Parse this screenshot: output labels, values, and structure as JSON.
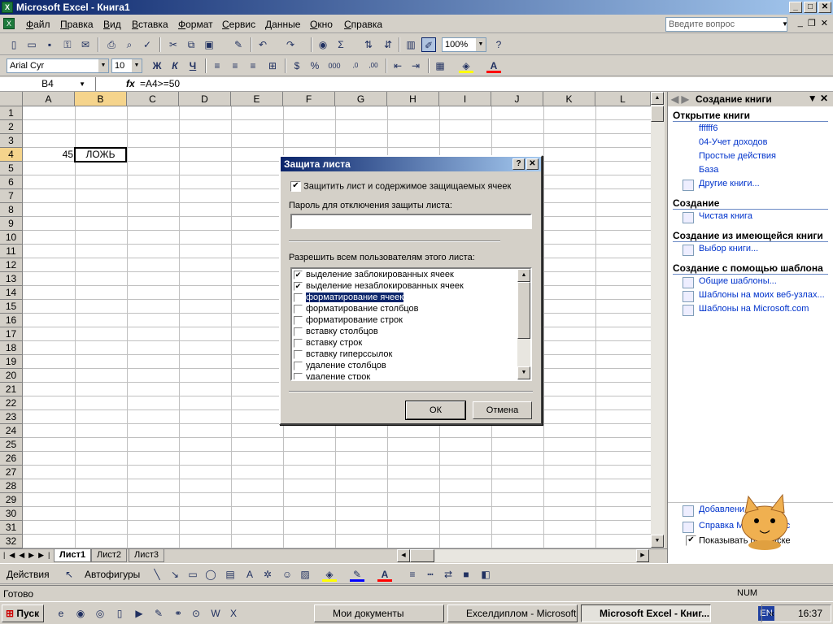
{
  "window": {
    "title": "Microsoft Excel - Книга1"
  },
  "menu": [
    "Файл",
    "Правка",
    "Вид",
    "Вставка",
    "Формат",
    "Сервис",
    "Данные",
    "Окно",
    "Справка"
  ],
  "question_box": {
    "placeholder": "Введите вопрос"
  },
  "toolbar": {
    "zoom": "100%",
    "font": "Arial Cyr",
    "size": "10",
    "bold": "Ж",
    "italic": "К",
    "underline": "Ч"
  },
  "formula_bar": {
    "name_box": "B4",
    "fx": "fx",
    "formula": "=A4>=50"
  },
  "columns": [
    "A",
    "B",
    "C",
    "D",
    "E",
    "F",
    "G",
    "H",
    "I",
    "J",
    "K",
    "L"
  ],
  "rows": [
    "1",
    "2",
    "3",
    "4",
    "5",
    "6",
    "7",
    "8",
    "9",
    "10",
    "11",
    "12",
    "13",
    "14",
    "15",
    "16",
    "17",
    "18",
    "19",
    "20",
    "21",
    "22",
    "23",
    "24",
    "25",
    "26",
    "27",
    "28",
    "29",
    "30",
    "31",
    "32"
  ],
  "cells": {
    "A4": "45",
    "B4": "ЛОЖЬ"
  },
  "sheets": [
    "Лист1",
    "Лист2",
    "Лист3"
  ],
  "drawbar": {
    "actions": "Действия",
    "autoshapes": "Автофигуры"
  },
  "status": {
    "left": "Готово",
    "num": "NUM"
  },
  "taskpane": {
    "title": "Создание книги",
    "open_title": "Открытие книги",
    "open_items": [
      "ffffff6",
      "04-Учет доходов",
      "Простые действия",
      "База"
    ],
    "other_books": "Другие книги...",
    "create_title": "Создание",
    "blank": "Чистая книга",
    "from_existing_title": "Создание из имеющейся книги",
    "choose_book": "Выбор книги...",
    "template_title": "Создание с помощью шаблона",
    "templates": [
      "Общие шаблоны...",
      "Шаблоны на моих веб-узлах...",
      "Шаблоны на Microsoft.com"
    ],
    "bottom": [
      "Добавлени",
      "Справка Microsoft Exc",
      "Показывать при пуске"
    ]
  },
  "dialog": {
    "title": "Защита листа",
    "protect_label": "Защитить лист и содержимое защищаемых ячеек",
    "password_label": "Пароль для отключения защиты листа:",
    "allow_label": "Разрешить всем пользователям этого листа:",
    "items": [
      {
        "label": "выделение заблокированных ячеек",
        "checked": true
      },
      {
        "label": "выделение незаблокированных ячеек",
        "checked": true
      },
      {
        "label": "форматирование ячеек",
        "checked": false
      },
      {
        "label": "форматирование столбцов",
        "checked": false
      },
      {
        "label": "форматирование строк",
        "checked": false
      },
      {
        "label": "вставку столбцов",
        "checked": false
      },
      {
        "label": "вставку строк",
        "checked": false
      },
      {
        "label": "вставку гиперссылок",
        "checked": false
      },
      {
        "label": "удаление столбцов",
        "checked": false
      },
      {
        "label": "удаление строк",
        "checked": false
      }
    ],
    "ok": "ОК",
    "cancel": "Отмена"
  },
  "taskbar": {
    "start": "Пуск",
    "buttons": [
      "Мои документы",
      "Exceлдиплом - Microsoft...",
      "Microsoft Excel - Книг..."
    ],
    "lang": "EN",
    "time": "16:37"
  }
}
